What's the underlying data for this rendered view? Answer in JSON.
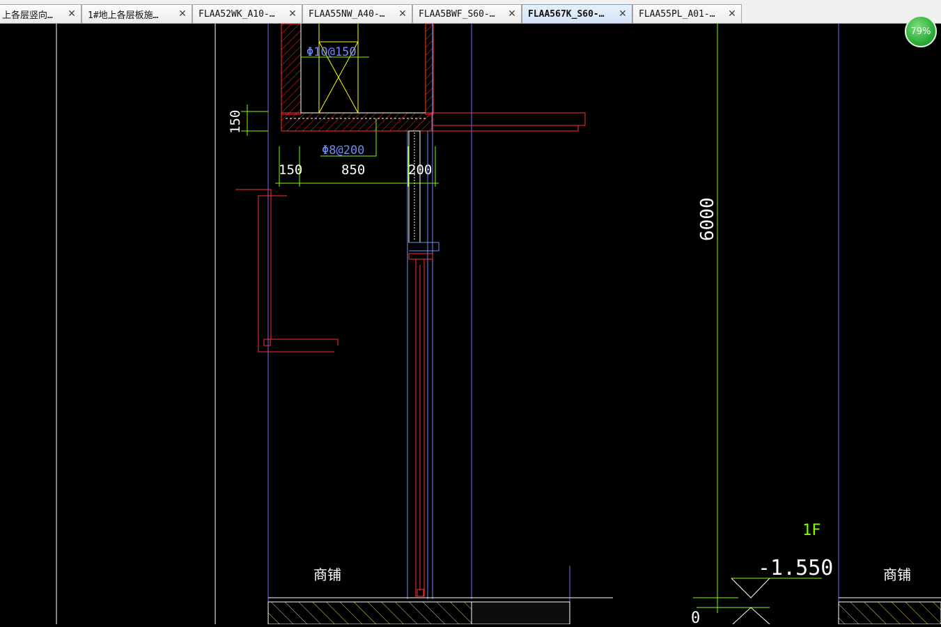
{
  "tabs": [
    {
      "label": "上各层竖向…",
      "active": false
    },
    {
      "label": "1#地上各层板施…",
      "active": false
    },
    {
      "label": "FLAA52WK_A10-…",
      "active": false
    },
    {
      "label": "FLAA55NW_A40-…",
      "active": false
    },
    {
      "label": "FLAA5BWF_S60-…",
      "active": false
    },
    {
      "label": "FLAA567K_S60-…",
      "active": true
    },
    {
      "label": "FLAA55PL_A01-…",
      "active": false
    }
  ],
  "close_glyph": "✕",
  "zoom": "79%",
  "drawing": {
    "rebar_upper": "Φ10@150",
    "rebar_lower": "Φ8@200",
    "dim_150_vert": "150",
    "dim_150": "150",
    "dim_850": "850",
    "dim_200": "200",
    "dim_6000": "6000",
    "floor_label": "1F",
    "elevation": "-1.550",
    "room_left": "商铺",
    "room_right": "商铺",
    "partial_zero": "0"
  },
  "colors": {
    "background": "#000000",
    "structure": "#ff3030",
    "dimension": "#7fff00",
    "annotation": "#ffffff",
    "hatch": "#ffff00",
    "guide": "#7b68ee",
    "rebar_label": "#6f8cff"
  }
}
